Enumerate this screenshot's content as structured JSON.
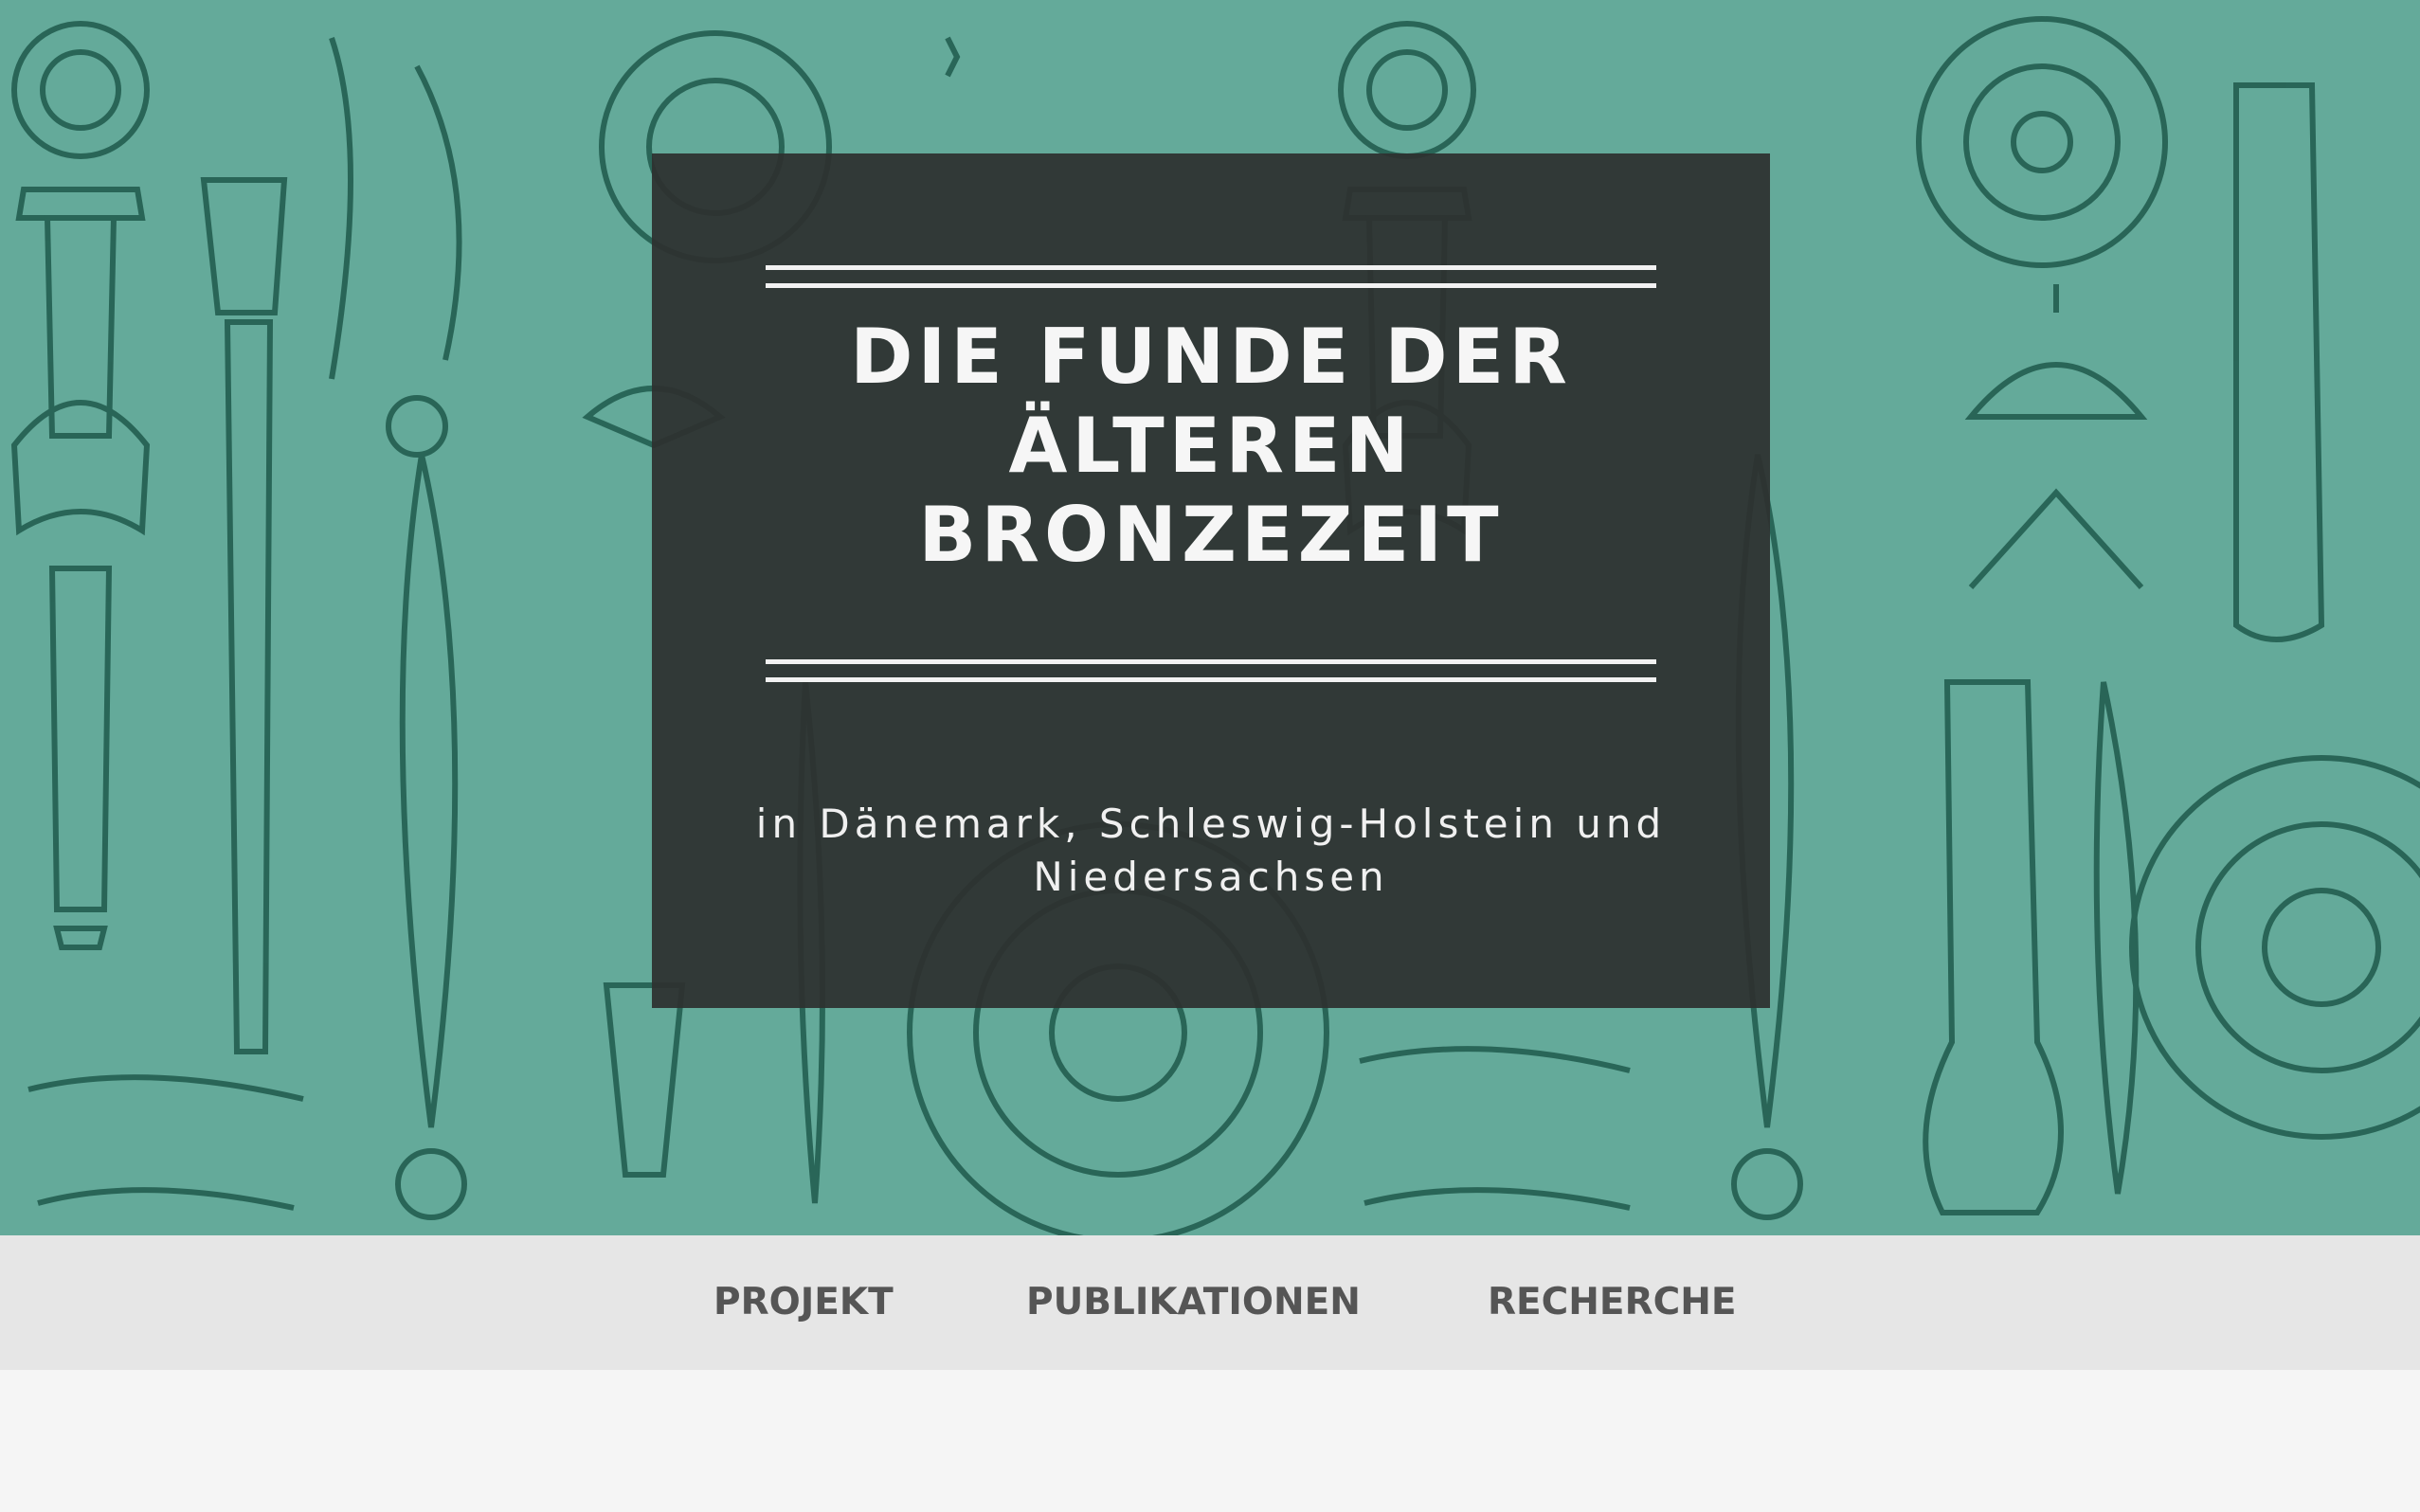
{
  "colors": {
    "hero_background": "#64aa9a",
    "artifact_ink": "#1f5a4c",
    "title_box": "#2d302f",
    "nav_background": "#e6e6e6",
    "nav_text": "#555555",
    "page_background": "#f5f5f5"
  },
  "hero": {
    "image": "bronze-age-artifacts-illustration",
    "title_lines": [
      "DIE FUNDE DER",
      "ÄLTEREN",
      "BRONZEZEIT"
    ],
    "subtitle_lines": [
      "in Dänemark, Schleswig-Holstein und",
      "Niedersachsen"
    ]
  },
  "nav": {
    "items": [
      {
        "label": "PROJEKT"
      },
      {
        "label": "PUBLIKATIONEN"
      },
      {
        "label": "RECHERCHE"
      }
    ]
  }
}
